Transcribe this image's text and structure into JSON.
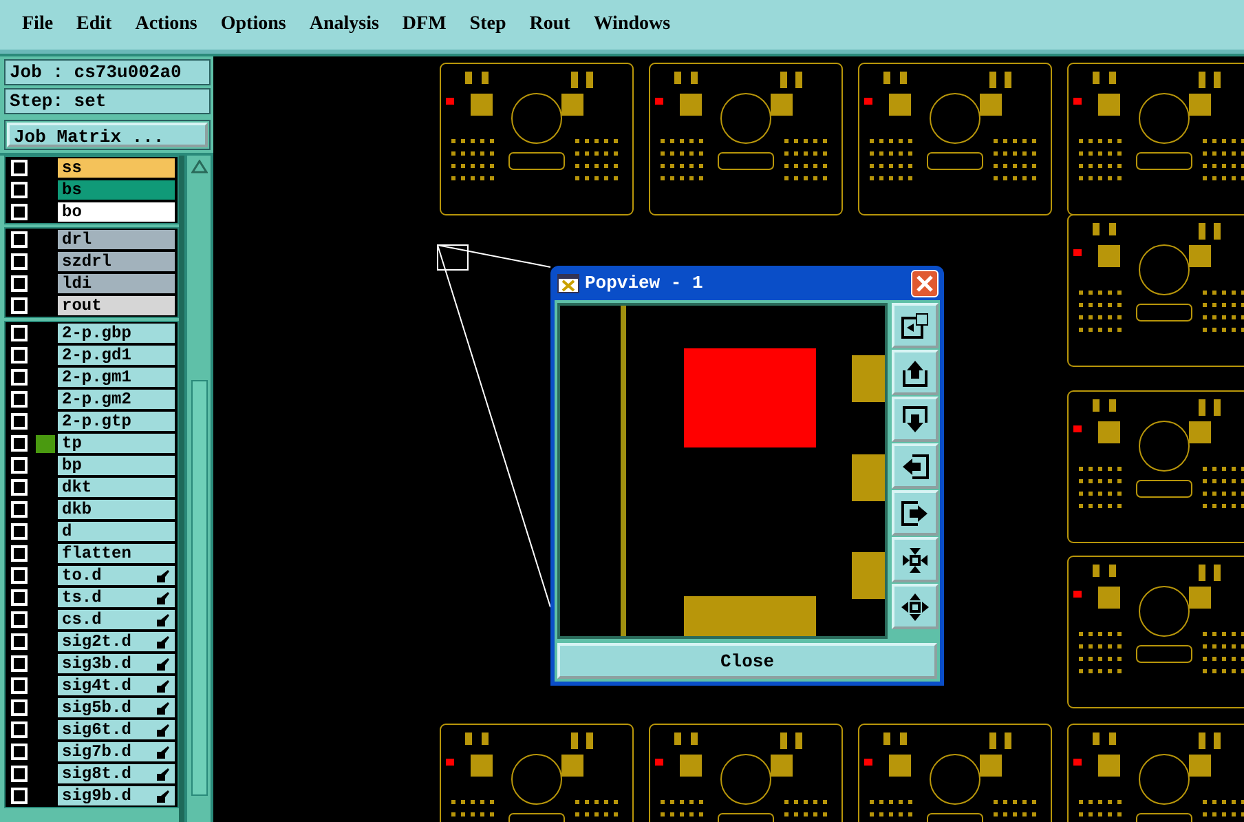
{
  "menu": [
    "File",
    "Edit",
    "Actions",
    "Options",
    "Analysis",
    "DFM",
    "Step",
    "Rout",
    "Windows"
  ],
  "job": {
    "job_label": "Job : cs73u002a0",
    "step_label": "Step: set",
    "matrix_button": "Job Matrix ..."
  },
  "layer_groups": [
    [
      {
        "name": "ss",
        "color": "#f4c25a",
        "checked": false,
        "kind": "plain"
      },
      {
        "name": "bs",
        "color": "#109a78",
        "checked": false,
        "kind": "plain"
      },
      {
        "name": "bo",
        "color": "#ffffff",
        "checked": false,
        "kind": "plain"
      }
    ],
    [
      {
        "name": "drl",
        "color": "#a2b2bc",
        "checked": false,
        "kind": "plain"
      },
      {
        "name": "szdrl",
        "color": "#a2b2bc",
        "checked": false,
        "kind": "plain"
      },
      {
        "name": "ldi",
        "color": "#a2b2bc",
        "checked": false,
        "kind": "plain"
      },
      {
        "name": "rout",
        "color": "#d6d6d6",
        "checked": false,
        "kind": "plain"
      }
    ],
    [
      {
        "name": "2-p.gbp",
        "color": "#a0dcdc",
        "checked": false,
        "kind": "plain"
      },
      {
        "name": "2-p.gd1",
        "color": "#a0dcdc",
        "checked": false,
        "kind": "plain"
      },
      {
        "name": "2-p.gm1",
        "color": "#a0dcdc",
        "checked": false,
        "kind": "plain"
      },
      {
        "name": "2-p.gm2",
        "color": "#a0dcdc",
        "checked": false,
        "kind": "plain"
      },
      {
        "name": "2-p.gtp",
        "color": "#a0dcdc",
        "checked": false,
        "kind": "plain"
      },
      {
        "name": "tp",
        "color": "#a0dcdc",
        "checked": false,
        "kind": "plain",
        "work_layer": true
      },
      {
        "name": "bp",
        "color": "#a0dcdc",
        "checked": false,
        "kind": "plain"
      },
      {
        "name": "dkt",
        "color": "#a0dcdc",
        "checked": false,
        "kind": "plain"
      },
      {
        "name": "dkb",
        "color": "#a0dcdc",
        "checked": false,
        "kind": "plain"
      },
      {
        "name": "d",
        "color": "#a0dcdc",
        "checked": false,
        "kind": "plain"
      },
      {
        "name": "flatten",
        "color": "#a0dcdc",
        "checked": false,
        "kind": "plain"
      },
      {
        "name": "to.d",
        "color": "#a0dcdc",
        "checked": false,
        "kind": "drill"
      },
      {
        "name": "ts.d",
        "color": "#a0dcdc",
        "checked": false,
        "kind": "drill"
      },
      {
        "name": "cs.d",
        "color": "#a0dcdc",
        "checked": false,
        "kind": "drill"
      },
      {
        "name": "sig2t.d",
        "color": "#a0dcdc",
        "checked": false,
        "kind": "drill"
      },
      {
        "name": "sig3b.d",
        "color": "#a0dcdc",
        "checked": false,
        "kind": "drill"
      },
      {
        "name": "sig4t.d",
        "color": "#a0dcdc",
        "checked": false,
        "kind": "drill"
      },
      {
        "name": "sig5b.d",
        "color": "#a0dcdc",
        "checked": false,
        "kind": "drill"
      },
      {
        "name": "sig6t.d",
        "color": "#a0dcdc",
        "checked": false,
        "kind": "drill"
      },
      {
        "name": "sig7b.d",
        "color": "#a0dcdc",
        "checked": false,
        "kind": "drill"
      },
      {
        "name": "sig8t.d",
        "color": "#a0dcdc",
        "checked": false,
        "kind": "drill"
      },
      {
        "name": "sig9b.d",
        "color": "#a0dcdc",
        "checked": false,
        "kind": "drill"
      }
    ]
  ],
  "popview": {
    "title": "Popview - 1",
    "tools": [
      {
        "kind": "zoom-back"
      },
      {
        "kind": "pan-up"
      },
      {
        "kind": "pan-down"
      },
      {
        "kind": "pan-left"
      },
      {
        "kind": "pan-right"
      },
      {
        "kind": "zoom-in"
      },
      {
        "kind": "zoom-out"
      }
    ],
    "close_button": "Close"
  }
}
